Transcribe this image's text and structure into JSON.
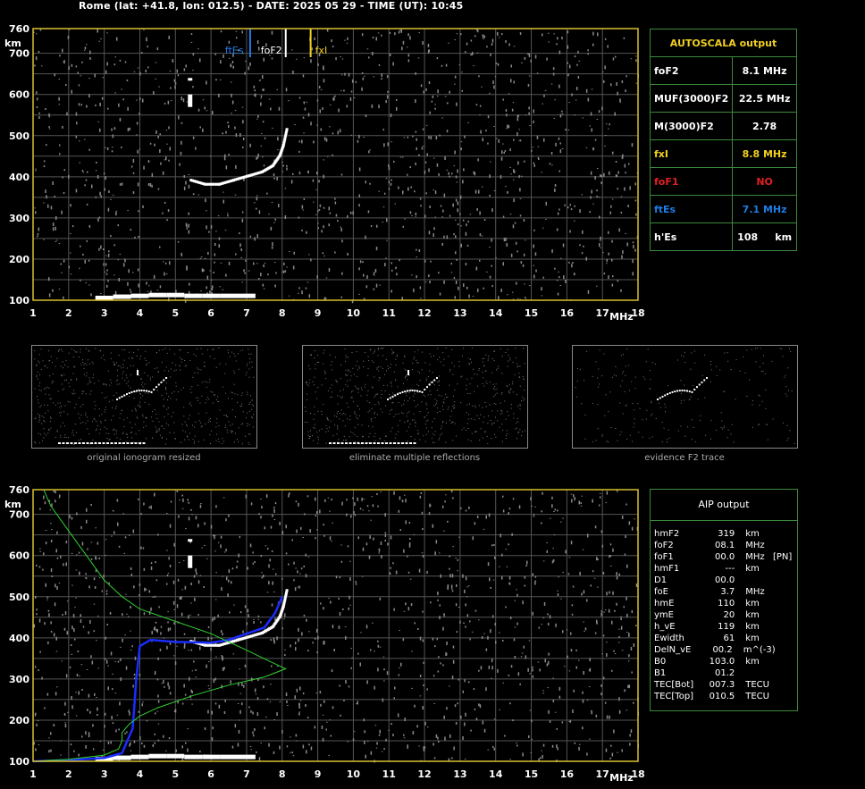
{
  "header": "Rome (lat: +41.8, lon: 012.5) - DATE: 2025 05 29 - TIME (UT): 10:45",
  "axes": {
    "y_unit": "km",
    "x_unit": "MHz",
    "y_ticks": [
      "100",
      "200",
      "300",
      "400",
      "500",
      "600",
      "700",
      "760"
    ],
    "x_ticks": [
      "1",
      "2",
      "3",
      "4",
      "5",
      "6",
      "7",
      "8",
      "9",
      "10",
      "11",
      "12",
      "13",
      "14",
      "15",
      "16",
      "17",
      "18"
    ],
    "xlim": [
      1,
      18
    ],
    "ylim": [
      100,
      760
    ]
  },
  "markers": [
    {
      "label": "ftEs",
      "freq": 7.1,
      "color": "#1e7de6"
    },
    {
      "label": "foF2",
      "freq": 8.1,
      "color": "#ffffff"
    },
    {
      "label": "fxI",
      "freq": 8.8,
      "color": "#f0d020"
    }
  ],
  "autoscala": {
    "title": "AUTOSCALA output",
    "rows": [
      {
        "name": "foF2",
        "value": "8.1 MHz",
        "color": "#ffffff"
      },
      {
        "name": "MUF(3000)F2",
        "value": "22.5 MHz",
        "color": "#ffffff"
      },
      {
        "name": "M(3000)F2",
        "value": "2.78",
        "color": "#ffffff"
      },
      {
        "name": "fxI",
        "value": "8.8 MHz",
        "color": "#f0d020"
      },
      {
        "name": "foF1",
        "value": "NO",
        "color": "#e02020"
      },
      {
        "name": "ftEs",
        "value": "7.1 MHz",
        "color": "#1e7de6"
      },
      {
        "name": "h'Es",
        "value": "108     km",
        "color": "#ffffff"
      }
    ]
  },
  "thumbnails": [
    {
      "caption": "original ionogram resized"
    },
    {
      "caption": "eliminate multiple reflections"
    },
    {
      "caption": "evidence F2 trace"
    }
  ],
  "aip": {
    "title": "AIP output",
    "rows": [
      [
        "hmF2",
        "319",
        "km",
        ""
      ],
      [
        "foF2",
        "08.1",
        "MHz",
        ""
      ],
      [
        "foF1",
        "00.0",
        "MHz",
        "[PN]"
      ],
      [
        "hmF1",
        "---",
        "km",
        ""
      ],
      [
        "D1",
        "00.0",
        "",
        ""
      ],
      [
        "foE",
        "3.7",
        "MHz",
        ""
      ],
      [
        "hmE",
        "110",
        "km",
        ""
      ],
      [
        "ymE",
        "20",
        "km",
        ""
      ],
      [
        "h_vE",
        "119",
        "km",
        ""
      ],
      [
        "Ewidth",
        "61",
        "km",
        ""
      ],
      [
        "DelN_vE",
        "00.2",
        "m^(-3)",
        ""
      ],
      [
        "B0",
        "103.0",
        "km",
        ""
      ],
      [
        "B1",
        "01.2",
        "",
        ""
      ],
      [
        "TEC[Bot]",
        "007.3",
        "TECU",
        ""
      ],
      [
        "TEC[Top]",
        "010.5",
        "TECU",
        ""
      ]
    ]
  },
  "chart_data": [
    {
      "type": "scatter",
      "title": "",
      "xlabel": "MHz",
      "ylabel": "km",
      "xlim": [
        1,
        18
      ],
      "ylim": [
        100,
        760
      ],
      "grid": true,
      "series": [
        {
          "values": [
            [
              3.0,
              105
            ],
            [
              3.5,
              108
            ],
            [
              4.0,
              110
            ],
            [
              4.5,
              112
            ],
            [
              5.0,
              112
            ],
            [
              5.5,
              110
            ],
            [
              6.0,
              110
            ],
            [
              6.5,
              110
            ],
            [
              7.0,
              110
            ]
          ]
        },
        {
          "values": [
            [
              5.4,
              395
            ],
            [
              5.8,
              385
            ],
            [
              6.2,
              385
            ],
            [
              6.6,
              395
            ],
            [
              7.0,
              405
            ],
            [
              7.4,
              415
            ],
            [
              7.7,
              430
            ],
            [
              7.9,
              455
            ],
            [
              8.0,
              480
            ],
            [
              8.1,
              520
            ]
          ]
        }
      ]
    },
    {
      "type": "line",
      "title": "",
      "xlabel": "MHz",
      "ylabel": "km",
      "xlim": [
        1,
        18
      ],
      "ylim": [
        100,
        760
      ],
      "grid": true,
      "series": [
        {
          "color": "#1a2cff",
          "values": [
            [
              1.0,
              100
            ],
            [
              2.0,
              103
            ],
            [
              3.0,
              108
            ],
            [
              3.5,
              120
            ],
            [
              3.8,
              180
            ],
            [
              3.9,
              300
            ],
            [
              4.0,
              380
            ],
            [
              4.3,
              395
            ],
            [
              5.0,
              390
            ],
            [
              6.0,
              388
            ],
            [
              6.5,
              395
            ],
            [
              7.0,
              410
            ],
            [
              7.5,
              425
            ],
            [
              7.8,
              460
            ],
            [
              8.0,
              500
            ]
          ]
        },
        {
          "color": "#30d030",
          "values": [
            [
              1.3,
              760
            ],
            [
              1.5,
              720
            ],
            [
              2.0,
              660
            ],
            [
              2.5,
              600
            ],
            [
              3.0,
              540
            ],
            [
              3.5,
              500
            ],
            [
              4.0,
              470
            ],
            [
              5.0,
              440
            ],
            [
              6.0,
              410
            ],
            [
              7.0,
              370
            ],
            [
              7.6,
              345
            ],
            [
              8.1,
              325
            ],
            [
              7.5,
              305
            ],
            [
              6.5,
              285
            ],
            [
              5.5,
              260
            ],
            [
              4.5,
              230
            ],
            [
              4.0,
              210
            ],
            [
              3.7,
              190
            ],
            [
              3.5,
              170
            ],
            [
              3.5,
              150
            ],
            [
              3.4,
              130
            ],
            [
              3.0,
              115
            ],
            [
              2.0,
              105
            ],
            [
              1.0,
              100
            ]
          ]
        }
      ]
    }
  ]
}
